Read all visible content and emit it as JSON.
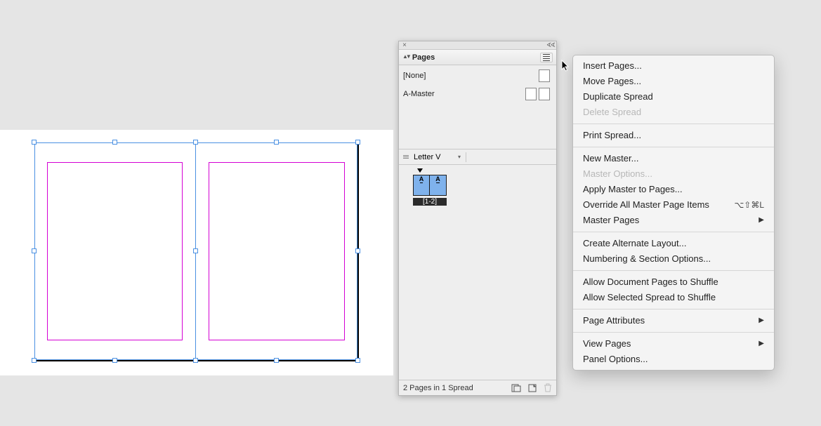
{
  "panel": {
    "title": "Pages",
    "close_glyph": "×",
    "collapse_glyph": "∢∢",
    "masters": {
      "none_label": "[None]",
      "a_master_label": "A-Master"
    },
    "section": {
      "layout_name": "Letter V"
    },
    "pages": {
      "spread_page_letters": [
        "A",
        "A"
      ],
      "spread_label": "[1-2]"
    },
    "footer": {
      "status": "2 Pages in 1 Spread"
    }
  },
  "menu": {
    "items": [
      {
        "label": "Insert Pages...",
        "disabled": false
      },
      {
        "label": "Move Pages...",
        "disabled": false
      },
      {
        "label": "Duplicate Spread",
        "disabled": false
      },
      {
        "label": "Delete Spread",
        "disabled": true
      },
      {
        "sep": true
      },
      {
        "label": "Print Spread...",
        "disabled": false
      },
      {
        "sep": true
      },
      {
        "label": "New Master...",
        "disabled": false
      },
      {
        "label": "Master Options...",
        "disabled": true
      },
      {
        "label": "Apply Master to Pages...",
        "disabled": false
      },
      {
        "label": "Override All Master Page Items",
        "disabled": false,
        "shortcut": "⌥⇧⌘L"
      },
      {
        "label": "Master Pages",
        "disabled": false,
        "submenu": true
      },
      {
        "sep": true
      },
      {
        "label": "Create Alternate Layout...",
        "disabled": false
      },
      {
        "label": "Numbering & Section Options...",
        "disabled": false
      },
      {
        "sep": true
      },
      {
        "label": "Allow Document Pages to Shuffle",
        "disabled": false
      },
      {
        "label": "Allow Selected Spread to Shuffle",
        "disabled": false
      },
      {
        "sep": true
      },
      {
        "label": "Page Attributes",
        "disabled": false,
        "submenu": true
      },
      {
        "sep": true
      },
      {
        "label": "View Pages",
        "disabled": false,
        "submenu": true
      },
      {
        "label": "Panel Options...",
        "disabled": false
      }
    ]
  }
}
